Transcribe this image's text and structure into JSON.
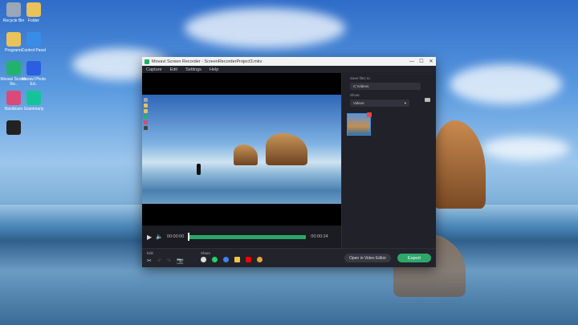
{
  "desktop": {
    "icons": [
      {
        "label": "Recycle Bin",
        "icon": "recycle-bin-icon",
        "color": "#9aa7b8"
      },
      {
        "label": "Folder",
        "icon": "folder-icon",
        "color": "#e9c25a"
      },
      {
        "label": "Programs",
        "icon": "folder-icon",
        "color": "#e9c25a"
      },
      {
        "label": "Control Panel",
        "icon": "control-panel-icon",
        "color": "#3a8de6"
      },
      {
        "label": "Movavi Screen Re..",
        "icon": "movavi-screen-icon",
        "color": "#23b26d"
      },
      {
        "label": "Movavi Photo Ed..",
        "icon": "movavi-photo-icon",
        "color": "#2b5fe0"
      },
      {
        "label": "Bandicam",
        "icon": "bandicam-icon",
        "color": "#d94a7a"
      },
      {
        "label": "Grammarly",
        "icon": "grammarly-icon",
        "color": "#15c39a"
      },
      {
        "label": "",
        "icon": "power-icon",
        "color": "#222222"
      }
    ]
  },
  "window": {
    "title": "Movavi Screen Recorder - ScreenRecorderProject3.mkv",
    "controls": {
      "minimize": "—",
      "maximize": "☐",
      "close": "✕"
    }
  },
  "menu": [
    "Capture",
    "Edit",
    "Settings",
    "Help"
  ],
  "side_panel": {
    "save_label": "Save files to:",
    "save_path": "C:\\Videos",
    "show_label": "Show:",
    "show_value": "Videos"
  },
  "player": {
    "current_time": "00:00:00",
    "end_time": "00:00:24",
    "progress": 0.0
  },
  "bottom": {
    "edit_label": "Edit",
    "share_label": "Share",
    "open_button": "Open in Video Editor",
    "export_button": "Export"
  },
  "colors": {
    "accent": "#2ea86a"
  }
}
